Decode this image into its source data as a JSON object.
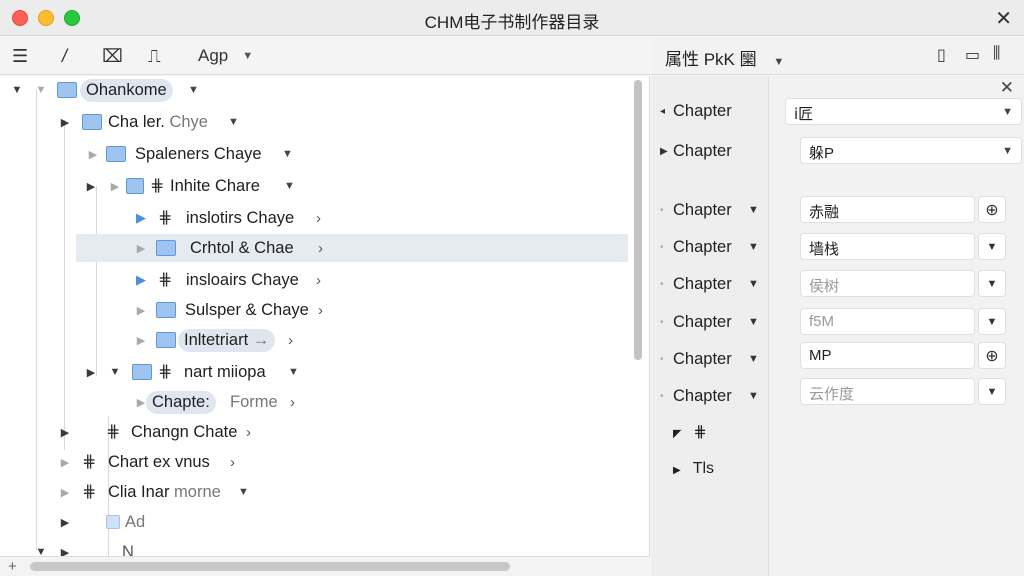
{
  "window": {
    "title": "CHM电子书制作器目录"
  },
  "toolbar": {
    "lang_label": "Agp"
  },
  "tree": {
    "root": "Ohankome",
    "r1": "Cha ler.",
    "r1_muted": "Chye",
    "r2": "Spaleners Chaye",
    "r3": "Inhite Chare",
    "r4": "inslotirs Chaye",
    "r5": "Crhtol & Chae",
    "r6": "insloairs Chaye",
    "r7": "Sulsper & Chaye",
    "r8": "Inltetriart",
    "r8_suffix": "→",
    "r9": "nart miiopa",
    "r10": "Chapte:",
    "r10_muted": "Forme",
    "r11": "Changn Chate",
    "r12": "Chart ex vnus",
    "r13": "Clia Inar",
    "r13_muted": "morne",
    "r14": "Ad",
    "r15": "N"
  },
  "props": {
    "header": "属性 PkK 圞",
    "items": [
      {
        "label": "Chapter"
      },
      {
        "label": "Chapter"
      },
      {
        "label": "Chapter"
      },
      {
        "label": "Chapter"
      },
      {
        "label": "Chapter"
      },
      {
        "label": "Chapter"
      },
      {
        "label": "Chapter"
      },
      {
        "label": "Chapter"
      }
    ],
    "fields": [
      {
        "value": "ⅰ匠"
      },
      {
        "value": "躲P"
      },
      {
        "value": "赤融"
      },
      {
        "value": "墙栈"
      },
      {
        "value": "侯树"
      },
      {
        "value": "f5M"
      },
      {
        "value": "MP"
      },
      {
        "value": "云作度"
      }
    ],
    "sub1": "⋕",
    "sub2": "Tls"
  },
  "icons": {
    "menu": "hamburger-icon",
    "italic": "italic-icon",
    "find": "find-replace-icon",
    "split": "split-icon",
    "window": "window-icon"
  },
  "colors": {
    "folder": "#9fc4ef",
    "selection": "#e6ebf1",
    "accent": "#4a8fe0"
  }
}
